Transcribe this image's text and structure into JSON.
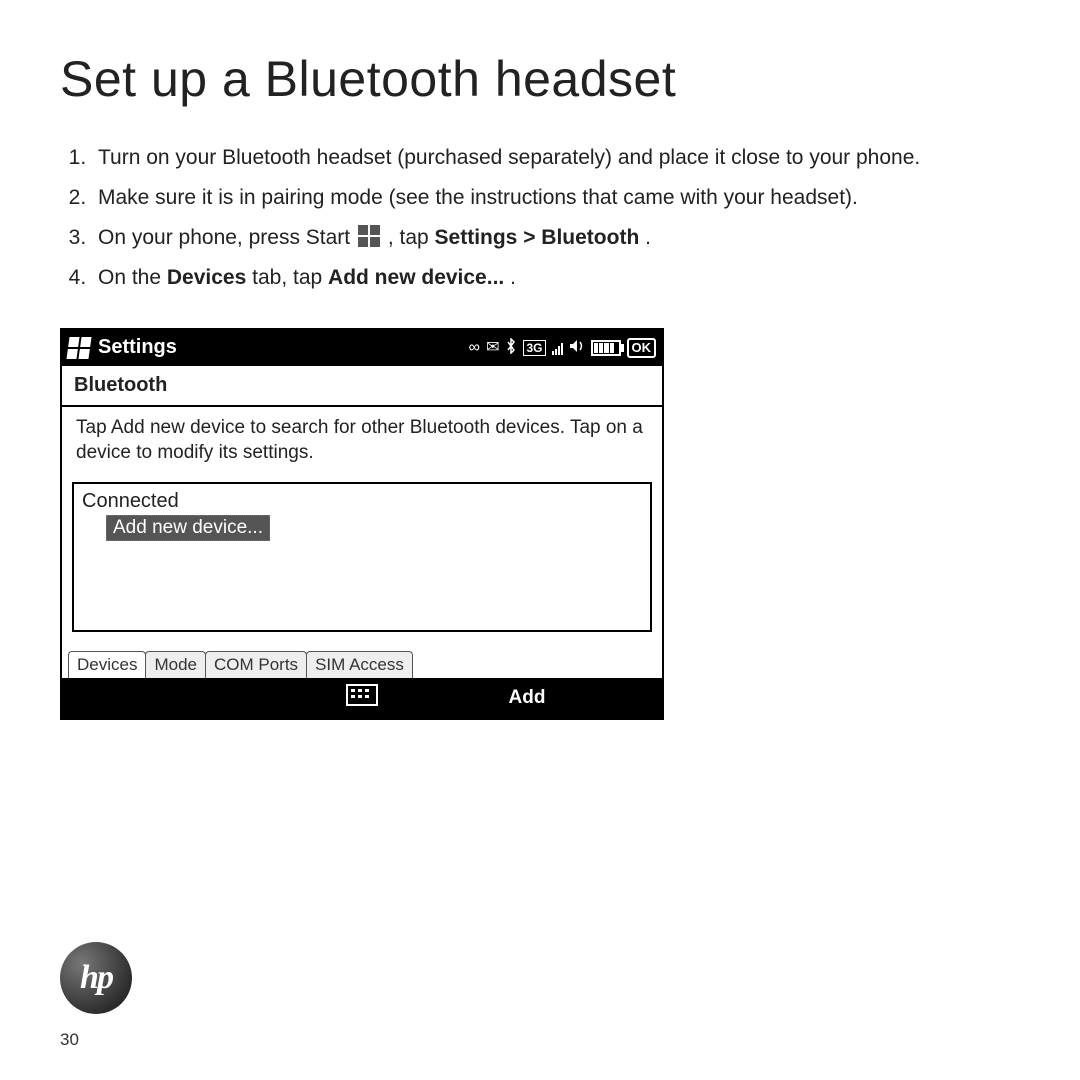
{
  "title": "Set up a Bluetooth headset",
  "steps": {
    "s1": "Turn on your Bluetooth headset (purchased separately) and place it close to your phone.",
    "s2": "Make sure it is in pairing mode (see the instructions that came with your headset).",
    "s3_pre": "On your phone, press Start ",
    "s3_post_plain": ", tap ",
    "s3_bold": "Settings > Bluetooth",
    "s3_end": ".",
    "s4_pre": "On the ",
    "s4_b1": "Devices",
    "s4_mid": " tab, tap ",
    "s4_b2": "Add new device...",
    "s4_end": "."
  },
  "screenshot": {
    "titlebar": "Settings",
    "status": {
      "voicemail": "ꙩ",
      "mail": "✉",
      "bluetooth": "✱",
      "net_badge": "3G",
      "ok": "OK"
    },
    "subheader": "Bluetooth",
    "instruction": "Tap Add new device to search for other Bluetooth devices. Tap on a device to modify its settings.",
    "list": {
      "group": "Connected",
      "selected_item": "Add new device..."
    },
    "tabs": [
      "Devices",
      "Mode",
      "COM Ports",
      "SIM Access"
    ],
    "softbar": {
      "left": "",
      "right": "Add"
    }
  },
  "footer": {
    "logo_text": "hp",
    "page_number": "30"
  }
}
